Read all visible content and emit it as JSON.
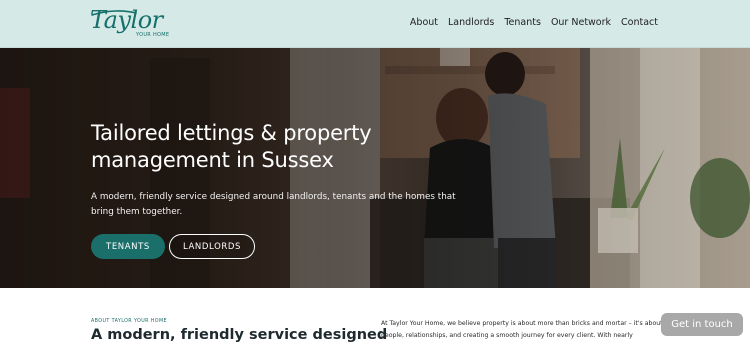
{
  "header": {
    "logo": {
      "script": "Taylor",
      "sub": "YOUR HOME"
    },
    "nav": [
      "About",
      "Landlords",
      "Tenants",
      "Our Network",
      "Contact"
    ]
  },
  "hero": {
    "title": "Tailored lettings & property management in Sussex",
    "subtitle": "A modern, friendly service designed around landlords, tenants and the homes that bring them together.",
    "buttons": {
      "tenants": "TENANTS",
      "landlords": "LANDLORDS"
    }
  },
  "about": {
    "eyebrow": "ABOUT TAYLOR YOUR HOME",
    "title": "A modern, friendly service designed",
    "text": "At Taylor Your Home, we believe property is about more than bricks and mortar – it's about people, relationships, and creating a smooth journey for every client. With nearly"
  },
  "chat": {
    "label": "Get in touch"
  },
  "colors": {
    "brand": "#1a6f6b",
    "header_bg": "#d5e9e6"
  }
}
